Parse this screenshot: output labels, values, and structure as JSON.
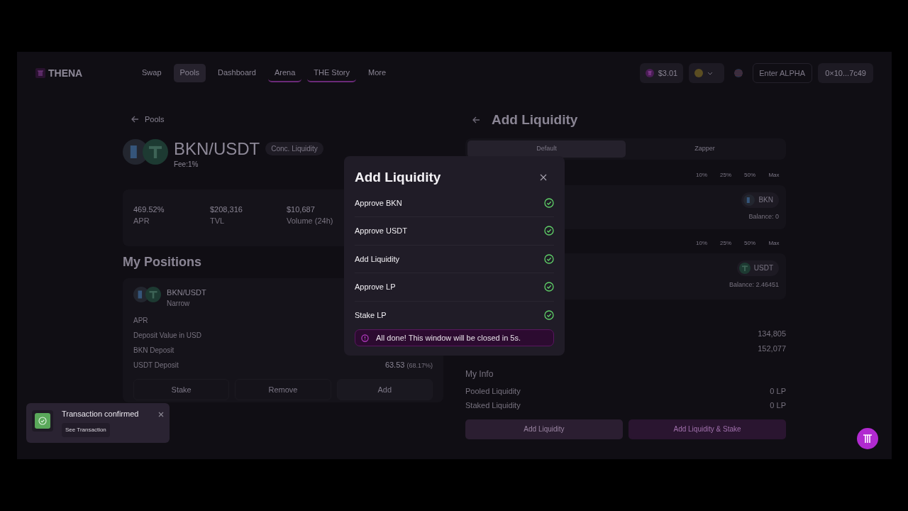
{
  "header": {
    "logo": "THENA",
    "nav": [
      {
        "label": "Swap",
        "selected": false,
        "underlined": false
      },
      {
        "label": "Pools",
        "selected": true,
        "underlined": false
      },
      {
        "label": "Dashboard",
        "selected": false,
        "underlined": false
      },
      {
        "label": "Arena",
        "selected": false,
        "underlined": true
      },
      {
        "label": "THE Story",
        "selected": false,
        "underlined": true
      },
      {
        "label": "More",
        "selected": false,
        "underlined": false
      }
    ],
    "price": "$3.01",
    "alpha": {
      "placeholder": "Enter ALPHA"
    },
    "wallet": "0×10...7c49"
  },
  "pool": {
    "back": "Pools",
    "pair": "BKN/USDT",
    "badge": "Conc. Liquidity",
    "fee": "Fee:1%",
    "stats": [
      {
        "value": "469.52%",
        "label": "APR"
      },
      {
        "value": "$208,316",
        "label": "TVL"
      },
      {
        "value": "$10,687",
        "label": "Volume (24h)"
      }
    ]
  },
  "positions": {
    "heading": "My Positions",
    "pair": "BKN/USDT",
    "range": "Narrow",
    "rows": [
      {
        "label": "APR"
      },
      {
        "label": "Deposit Value in USD"
      },
      {
        "label": "BKN Deposit"
      },
      {
        "label": "USDT Deposit",
        "value": "63.53",
        "share": "(68.17%)"
      }
    ],
    "buttons": [
      "Stake",
      "Remove",
      "Add"
    ]
  },
  "add_liquidity": {
    "title": "Add Liquidity",
    "tabs": [
      {
        "label": "Default",
        "selected": true
      },
      {
        "label": "Zapper",
        "selected": false
      }
    ],
    "inputs": [
      {
        "percents": [
          "10%",
          "25%",
          "50%",
          "Max"
        ],
        "token": "BKN",
        "balance": "Balance: 0"
      },
      {
        "percents": [
          "10%",
          "25%",
          "50%",
          "Max"
        ],
        "token": "USDT",
        "balance": "Balance: 2.46451"
      }
    ],
    "amounts": [
      "134,805",
      "152,077"
    ],
    "my_info": {
      "heading": "My Info",
      "rows": [
        {
          "label": "Pooled Liquidity",
          "value": "0 LP"
        },
        {
          "label": "Staked Liquidity",
          "value": "0 LP"
        }
      ]
    },
    "buttons": [
      "Add Liquidity",
      "Add Liquidity & Stake"
    ]
  },
  "modal": {
    "title": "Add Liquidity",
    "steps": [
      {
        "label": "Approve BKN",
        "done": true
      },
      {
        "label": "Approve USDT",
        "done": true
      },
      {
        "label": "Add Liquidity",
        "done": true
      },
      {
        "label": "Approve LP",
        "done": true
      },
      {
        "label": "Stake LP",
        "done": true
      }
    ],
    "notice": "All done! This window will be closed in 5s."
  },
  "toast": {
    "title": "Transaction confirmed",
    "link": "See Transaction"
  }
}
